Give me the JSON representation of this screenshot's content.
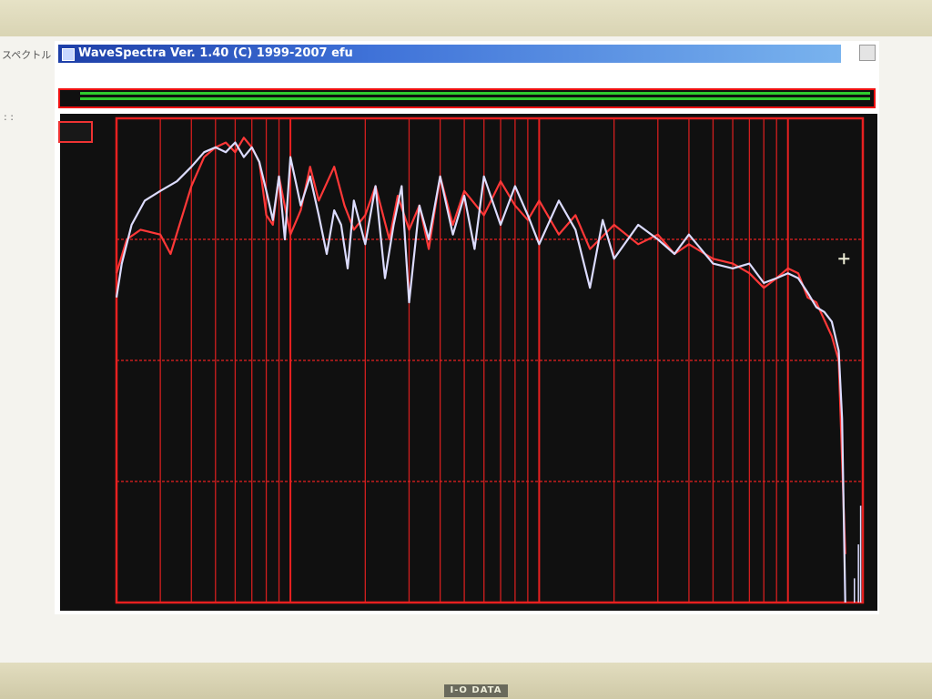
{
  "window": {
    "title": "WaveSpectra  Ver. 1.40  (C) 1999-2007 efu",
    "side_label": "スペクトル"
  },
  "bezel": {
    "brand": "I-O DATA"
  },
  "scale_bar": {
    "top_label": "",
    "bottom_label": "",
    "ticks": []
  },
  "colors": {
    "grid": "#e82020",
    "series_left": "#ff3838",
    "series_right": "#dcdcff",
    "plot_bg": "#101010",
    "axis_text": "#3f3"
  },
  "chart_data": {
    "type": "line",
    "x_scale": "log",
    "y_ticks": [],
    "x_ticks": [],
    "series": [
      {
        "color": "#ff3838",
        "points": [
          [
            20,
            -32
          ],
          [
            22,
            -25
          ],
          [
            25,
            -23
          ],
          [
            30,
            -24
          ],
          [
            33,
            -28
          ],
          [
            40,
            -14
          ],
          [
            45,
            -8
          ],
          [
            50,
            -6
          ],
          [
            55,
            -5
          ],
          [
            60,
            -7
          ],
          [
            65,
            -4
          ],
          [
            70,
            -6
          ],
          [
            75,
            -9
          ],
          [
            80,
            -20
          ],
          [
            85,
            -22
          ],
          [
            90,
            -12
          ],
          [
            100,
            -24
          ],
          [
            110,
            -19
          ],
          [
            120,
            -10
          ],
          [
            130,
            -17
          ],
          [
            150,
            -10
          ],
          [
            165,
            -18
          ],
          [
            180,
            -23
          ],
          [
            200,
            -20
          ],
          [
            220,
            -14
          ],
          [
            250,
            -25
          ],
          [
            270,
            -16
          ],
          [
            300,
            -23
          ],
          [
            330,
            -18
          ],
          [
            360,
            -27
          ],
          [
            400,
            -12
          ],
          [
            450,
            -22
          ],
          [
            500,
            -15
          ],
          [
            600,
            -20
          ],
          [
            700,
            -13
          ],
          [
            800,
            -18
          ],
          [
            900,
            -21
          ],
          [
            1000,
            -17
          ],
          [
            1200,
            -24
          ],
          [
            1400,
            -20
          ],
          [
            1600,
            -27
          ],
          [
            2000,
            -22
          ],
          [
            2500,
            -26
          ],
          [
            3000,
            -24
          ],
          [
            3500,
            -28
          ],
          [
            4000,
            -26
          ],
          [
            5000,
            -29
          ],
          [
            6000,
            -30
          ],
          [
            7000,
            -32
          ],
          [
            8000,
            -35
          ],
          [
            9000,
            -33
          ],
          [
            10000,
            -31
          ],
          [
            11000,
            -32
          ],
          [
            12000,
            -37
          ],
          [
            13000,
            -38
          ],
          [
            15000,
            -45
          ],
          [
            16000,
            -50
          ],
          [
            17000,
            -90
          ]
        ]
      },
      {
        "color": "#dcdcff",
        "points": [
          [
            20,
            -37
          ],
          [
            21,
            -30
          ],
          [
            23,
            -22
          ],
          [
            26,
            -17
          ],
          [
            30,
            -15
          ],
          [
            35,
            -13
          ],
          [
            40,
            -10
          ],
          [
            45,
            -7
          ],
          [
            50,
            -6
          ],
          [
            55,
            -7
          ],
          [
            60,
            -5
          ],
          [
            65,
            -8
          ],
          [
            70,
            -6
          ],
          [
            75,
            -9
          ],
          [
            80,
            -15
          ],
          [
            85,
            -21
          ],
          [
            90,
            -12
          ],
          [
            95,
            -25
          ],
          [
            100,
            -8
          ],
          [
            105,
            -13
          ],
          [
            110,
            -18
          ],
          [
            120,
            -12
          ],
          [
            130,
            -20
          ],
          [
            140,
            -28
          ],
          [
            150,
            -19
          ],
          [
            160,
            -22
          ],
          [
            170,
            -31
          ],
          [
            180,
            -17
          ],
          [
            200,
            -26
          ],
          [
            220,
            -14
          ],
          [
            240,
            -33
          ],
          [
            260,
            -22
          ],
          [
            280,
            -14
          ],
          [
            300,
            -38
          ],
          [
            330,
            -18
          ],
          [
            360,
            -25
          ],
          [
            400,
            -12
          ],
          [
            450,
            -24
          ],
          [
            500,
            -16
          ],
          [
            550,
            -27
          ],
          [
            600,
            -12
          ],
          [
            700,
            -22
          ],
          [
            800,
            -14
          ],
          [
            900,
            -20
          ],
          [
            1000,
            -26
          ],
          [
            1200,
            -17
          ],
          [
            1400,
            -23
          ],
          [
            1600,
            -35
          ],
          [
            1800,
            -21
          ],
          [
            2000,
            -29
          ],
          [
            2500,
            -22
          ],
          [
            3000,
            -25
          ],
          [
            3500,
            -28
          ],
          [
            4000,
            -24
          ],
          [
            5000,
            -30
          ],
          [
            6000,
            -31
          ],
          [
            7000,
            -30
          ],
          [
            8000,
            -34
          ],
          [
            9000,
            -33
          ],
          [
            10000,
            -32
          ],
          [
            11000,
            -33
          ],
          [
            12000,
            -36
          ],
          [
            13000,
            -39
          ],
          [
            14000,
            -40
          ],
          [
            15000,
            -42
          ],
          [
            16000,
            -48
          ],
          [
            16500,
            -62
          ],
          [
            17000,
            -100
          ]
        ]
      }
    ]
  }
}
